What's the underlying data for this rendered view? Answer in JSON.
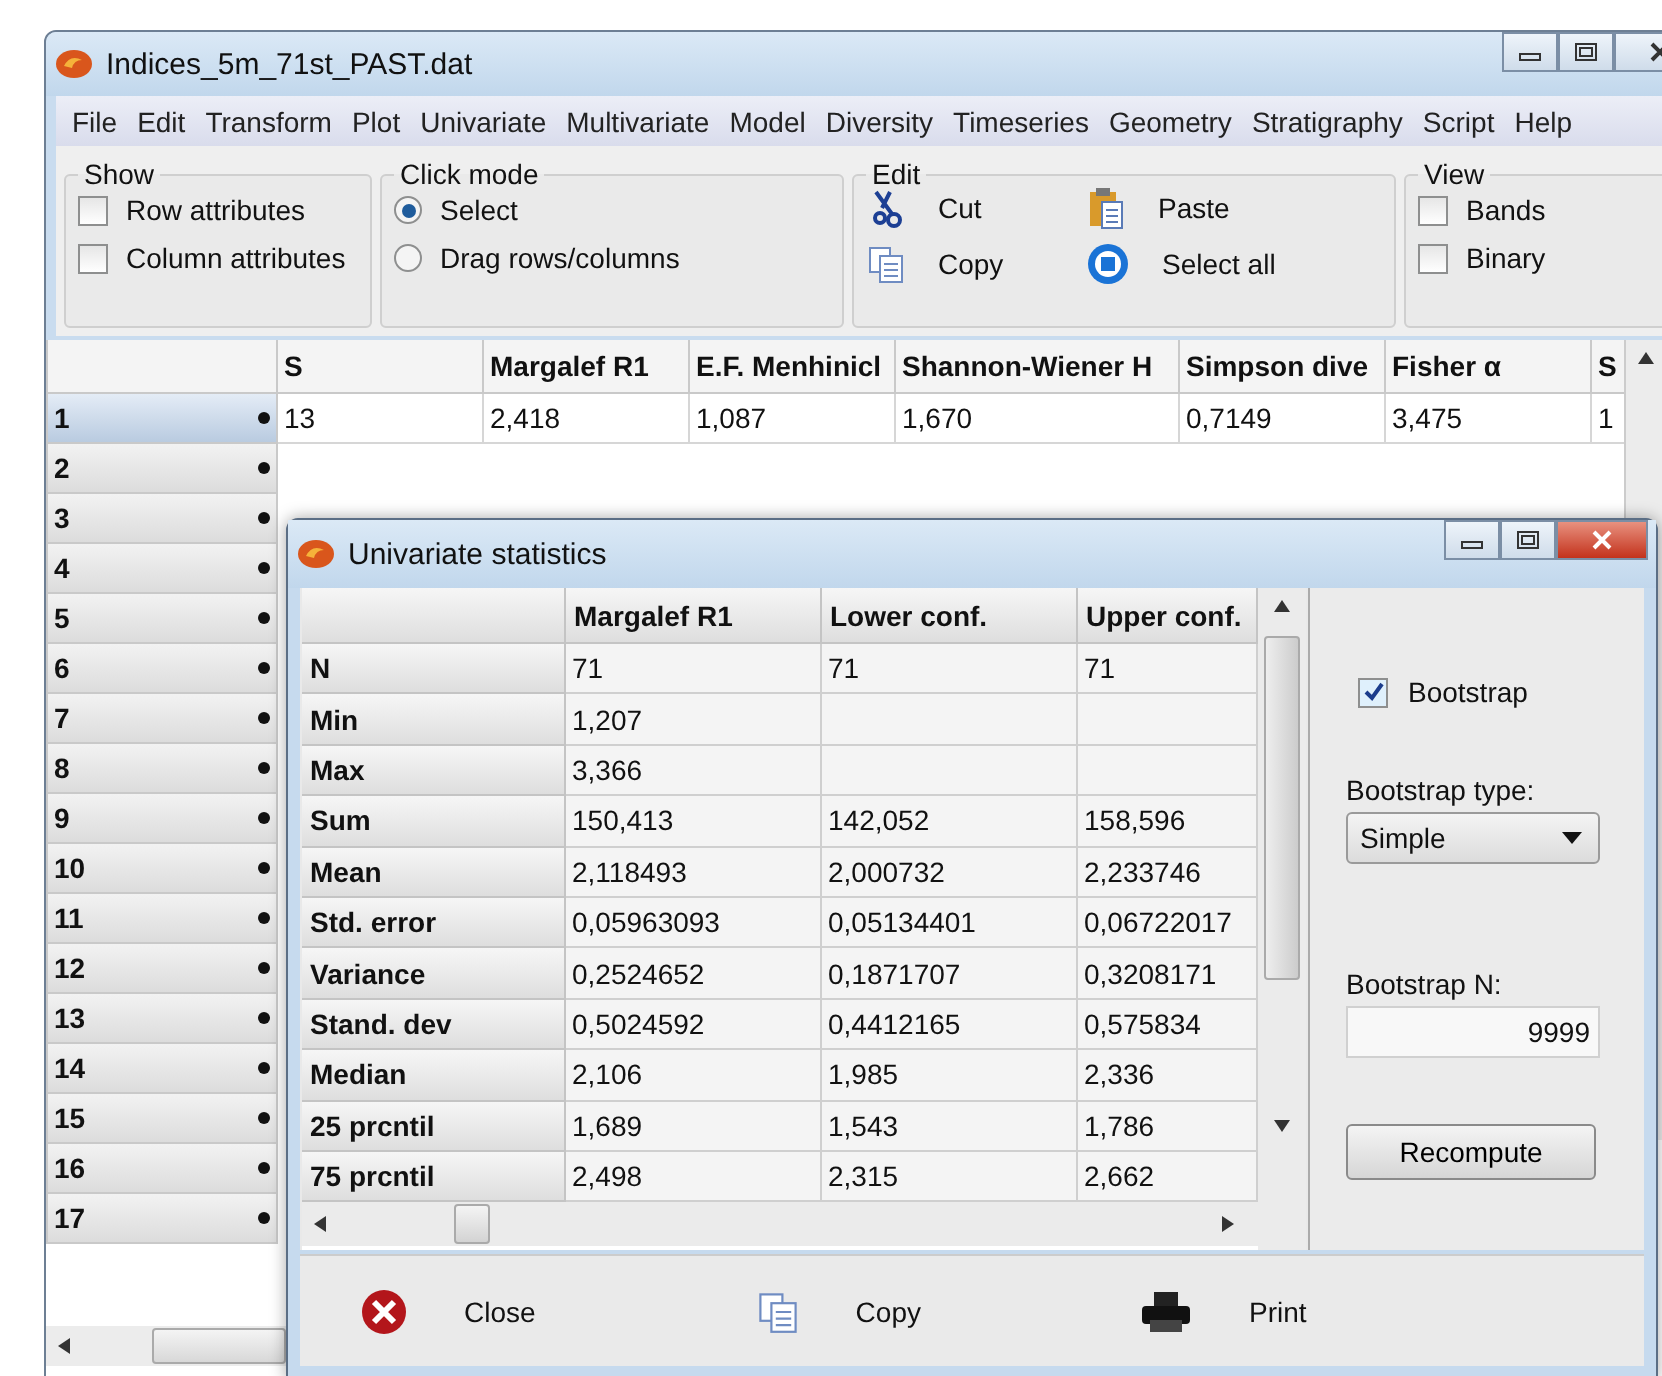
{
  "window": {
    "title": "Indices_5m_71st_PAST.dat"
  },
  "menu": [
    "File",
    "Edit",
    "Transform",
    "Plot",
    "Univariate",
    "Multivariate",
    "Model",
    "Diversity",
    "Timeseries",
    "Geometry",
    "Stratigraphy",
    "Script",
    "Help"
  ],
  "toolbar": {
    "show": {
      "title": "Show",
      "options": [
        {
          "label": "Row attributes",
          "checked": false
        },
        {
          "label": "Column attributes",
          "checked": false
        }
      ]
    },
    "click_mode": {
      "title": "Click mode",
      "options": [
        {
          "label": "Select",
          "selected": true
        },
        {
          "label": "Drag rows/columns",
          "selected": false
        }
      ]
    },
    "edit": {
      "title": "Edit",
      "buttons": [
        {
          "kind": "cut",
          "label": "Cut"
        },
        {
          "kind": "paste",
          "label": "Paste"
        },
        {
          "kind": "copy",
          "label": "Copy"
        },
        {
          "kind": "select_all",
          "label": "Select all"
        }
      ]
    },
    "view": {
      "title": "View",
      "options": [
        {
          "label": "Bands",
          "checked": false
        },
        {
          "label": "Binary",
          "checked": false
        }
      ]
    }
  },
  "table": {
    "columns": [
      "S",
      "Margalef R1",
      "E.F. Menhinicl",
      "Shannon-Wiener H",
      "Simpson dive",
      "Fisher α",
      "S"
    ],
    "rows": [
      {
        "index": "1",
        "selected": true,
        "cells": [
          "13",
          "2,418",
          "1,087",
          "1,670",
          "0,7149",
          "3,475",
          "1"
        ]
      },
      {
        "index": "2",
        "selected": false,
        "cells": []
      },
      {
        "index": "3",
        "selected": false,
        "cells": []
      },
      {
        "index": "4",
        "selected": false,
        "cells": []
      },
      {
        "index": "5",
        "selected": false,
        "cells": []
      },
      {
        "index": "6",
        "selected": false,
        "cells": []
      },
      {
        "index": "7",
        "selected": false,
        "cells": []
      },
      {
        "index": "8",
        "selected": false,
        "cells": []
      },
      {
        "index": "9",
        "selected": false,
        "cells": []
      },
      {
        "index": "10",
        "selected": false,
        "cells": []
      },
      {
        "index": "11",
        "selected": false,
        "cells": []
      },
      {
        "index": "12",
        "selected": false,
        "cells": []
      },
      {
        "index": "13",
        "selected": false,
        "cells": []
      },
      {
        "index": "14",
        "selected": false,
        "cells": []
      },
      {
        "index": "15",
        "selected": false,
        "cells": []
      },
      {
        "index": "16",
        "selected": false,
        "cells": []
      },
      {
        "index": "17",
        "selected": false,
        "cells": []
      }
    ]
  },
  "dialog": {
    "title": "Univariate statistics",
    "table": {
      "columns": [
        "Margalef R1",
        "Lower conf.",
        "Upper conf."
      ],
      "rows": [
        {
          "label": "N",
          "cells": [
            "71",
            "71",
            "71"
          ]
        },
        {
          "label": "Min",
          "cells": [
            "1,207"
          ]
        },
        {
          "label": "Max",
          "cells": [
            "3,366"
          ]
        },
        {
          "label": "Sum",
          "cells": [
            "150,413",
            "142,052",
            "158,596"
          ]
        },
        {
          "label": "Mean",
          "cells": [
            "2,118493",
            "2,000732",
            "2,233746"
          ]
        },
        {
          "label": "Std. error",
          "cells": [
            "0,05963093",
            "0,05134401",
            "0,06722017"
          ]
        },
        {
          "label": "Variance",
          "cells": [
            "0,2524652",
            "0,1871707",
            "0,3208171"
          ]
        },
        {
          "label": "Stand. dev",
          "cells": [
            "0,5024592",
            "0,4412165",
            "0,575834"
          ]
        },
        {
          "label": "Median",
          "cells": [
            "2,106",
            "1,985",
            "2,336"
          ]
        },
        {
          "label": "25 prcntil",
          "cells": [
            "1,689",
            "1,543",
            "1,786"
          ]
        },
        {
          "label": "75 prcntil",
          "cells": [
            "2,498",
            "2,315",
            "2,662"
          ]
        }
      ]
    },
    "bootstrap": {
      "label": "Bootstrap",
      "checked": true
    },
    "type_label": "Bootstrap type:",
    "type_value": "Simple",
    "n_label": "Bootstrap N:",
    "n_value": "9999",
    "recompute": "Recompute",
    "buttons": [
      {
        "kind": "close",
        "label": "Close"
      },
      {
        "kind": "copy",
        "label": "Copy"
      },
      {
        "kind": "print",
        "label": "Print"
      }
    ]
  }
}
